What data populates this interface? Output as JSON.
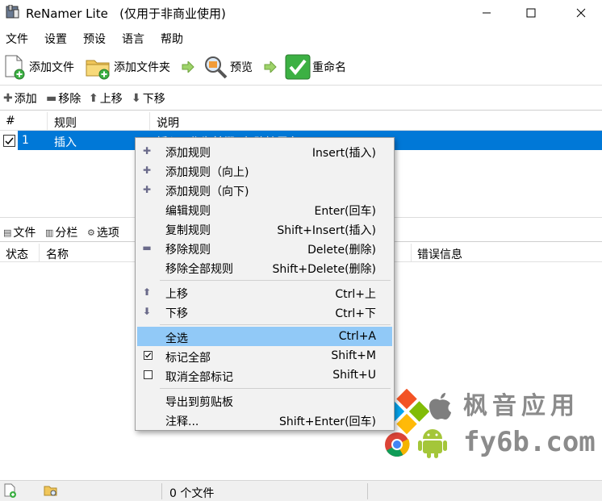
{
  "window": {
    "title": "ReNamer Lite",
    "subtitle": "(仅用于非商业使用)"
  },
  "menu": [
    "文件",
    "设置",
    "预设",
    "语言",
    "帮助"
  ],
  "toolbar": {
    "add_files": "添加文件",
    "add_folder": "添加文件夹",
    "preview": "预览",
    "rename": "重命名"
  },
  "rules_toolbar": {
    "add": "添加",
    "remove": "移除",
    "up": "上移",
    "down": "下移"
  },
  "rules_table": {
    "columns": [
      "#",
      "规则",
      "说明"
    ],
    "rows": [
      {
        "num": "1",
        "rule": "插入",
        "description": "插入\"\"作为前缀 (忽略扩展名)"
      }
    ]
  },
  "files_toolbar": {
    "files": "文件",
    "columns": "分栏",
    "options": "选项"
  },
  "files_table": {
    "columns": [
      "状态",
      "名称",
      "错误信息"
    ]
  },
  "status": {
    "file_count": "0 个文件"
  },
  "context_menu": {
    "items": [
      {
        "label": "添加规则",
        "shortcut": "Insert(插入)",
        "icon": "plus-icon"
      },
      {
        "label": "添加规则（向上)",
        "shortcut": "",
        "icon": "plus-icon"
      },
      {
        "label": "添加规则（向下)",
        "shortcut": "",
        "icon": "plus-icon"
      },
      {
        "label": "编辑规则",
        "shortcut": "Enter(回车)",
        "icon": ""
      },
      {
        "label": "复制规则",
        "shortcut": "Shift+Insert(插入)",
        "icon": ""
      },
      {
        "label": "移除规则",
        "shortcut": "Delete(删除)",
        "icon": "minus-icon"
      },
      {
        "label": "移除全部规则",
        "shortcut": "Shift+Delete(删除)",
        "icon": ""
      },
      {
        "label": "上移",
        "shortcut": "Ctrl+上",
        "icon": "arrow-up-icon"
      },
      {
        "label": "下移",
        "shortcut": "Ctrl+下",
        "icon": "arrow-down-icon"
      },
      {
        "label": "全选",
        "shortcut": "Ctrl+A",
        "icon": "",
        "highlighted": true
      },
      {
        "label": "标记全部",
        "shortcut": "Shift+M",
        "icon": "checkbox-checked-icon"
      },
      {
        "label": "取消全部标记",
        "shortcut": "Shift+U",
        "icon": "checkbox-empty-icon"
      },
      {
        "label": "导出到剪贴板",
        "shortcut": "",
        "icon": ""
      },
      {
        "label": "注释...",
        "shortcut": "Shift+Enter(回车)",
        "icon": ""
      }
    ]
  },
  "watermark": {
    "brand": "枫音应用",
    "domain": "fy6b.com"
  },
  "colors": {
    "selection": "#0078d7",
    "menu_highlight": "#91c9f7",
    "rename_green": "#3cb043"
  }
}
